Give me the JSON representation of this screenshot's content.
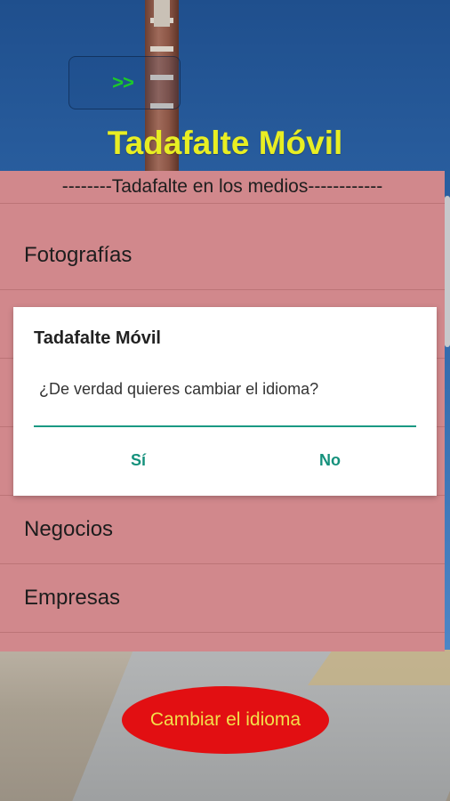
{
  "header": {
    "nav_arrow_label": ">>",
    "title": "Tadafalte Móvil"
  },
  "list": {
    "section_header": "--------Tadafalte en los medios------------",
    "items": [
      {
        "label": "Fotografías"
      },
      {
        "label": ""
      },
      {
        "label": ""
      },
      {
        "label": ""
      },
      {
        "label": "Negocios"
      },
      {
        "label": "Empresas"
      }
    ]
  },
  "dialog": {
    "title": "Tadafalte Móvil",
    "message": "¿De verdad quieres cambiar el idioma?",
    "yes_label": "Sí",
    "no_label": "No"
  },
  "footer": {
    "change_language_label": "Cambiar el idioma"
  },
  "colors": {
    "title_yellow": "#e8ee23",
    "arrow_green": "#1cc92a",
    "panel_pink": "#d1888c",
    "dialog_accent": "#15917c",
    "button_red": "#e20f12",
    "button_text": "#f3df4a"
  }
}
